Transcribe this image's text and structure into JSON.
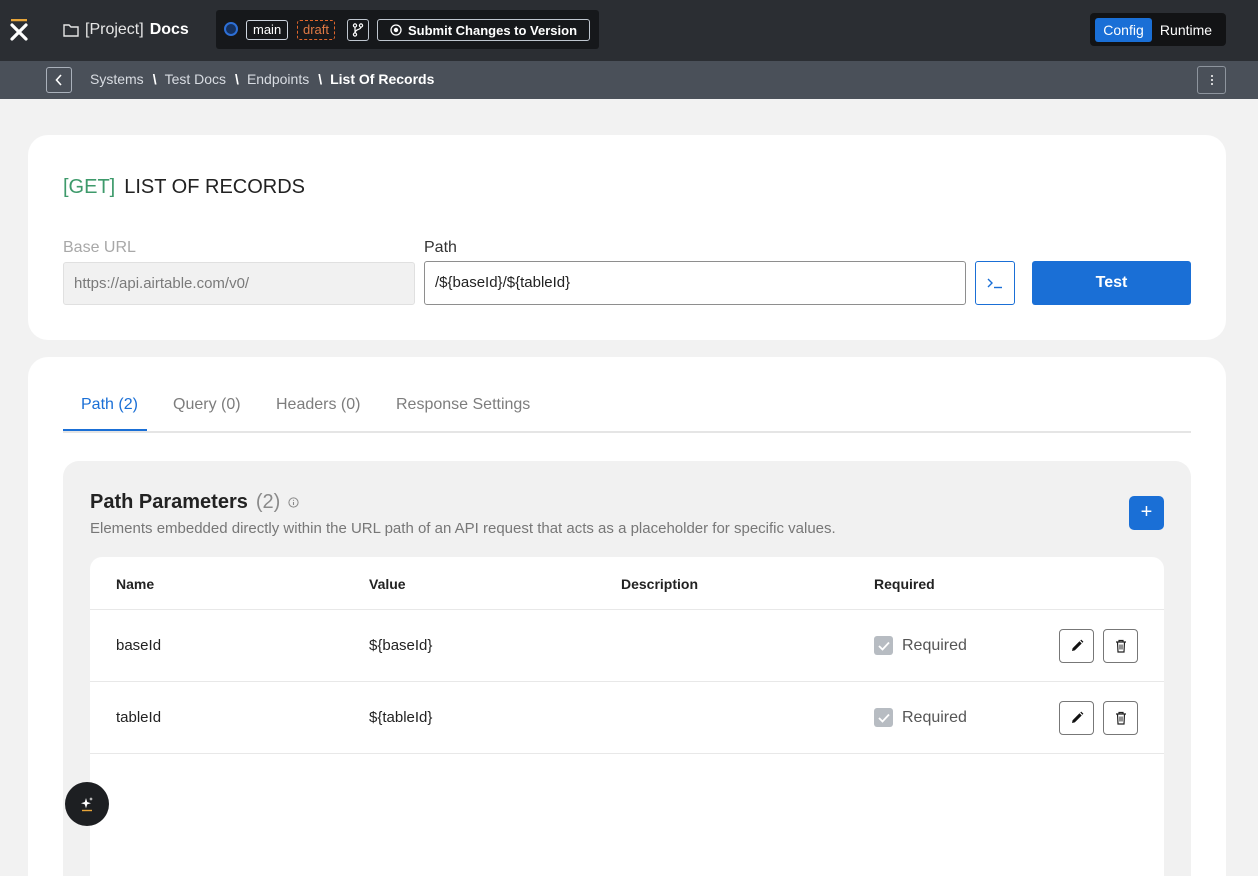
{
  "header": {
    "project_prefix": "[Project]",
    "project_name": "Docs",
    "branch": "main",
    "status": "draft",
    "submit_label": "Submit Changes to Version",
    "mode_config": "Config",
    "mode_runtime": "Runtime"
  },
  "breadcrumb": {
    "items": [
      "Systems",
      "Test Docs",
      "Endpoints",
      "List Of Records"
    ],
    "separator": "\\"
  },
  "endpoint": {
    "method": "[GET]",
    "name": "LIST OF RECORDS",
    "base_url_label": "Base URL",
    "base_url": "https://api.airtable.com/v0/",
    "path_label": "Path",
    "path": "/${baseId}/${tableId}",
    "test_label": "Test"
  },
  "tabs": [
    {
      "label": "Path (2)",
      "active": true
    },
    {
      "label": "Query (0)",
      "active": false
    },
    {
      "label": "Headers (0)",
      "active": false
    },
    {
      "label": "Response Settings",
      "active": false
    }
  ],
  "path_params": {
    "title": "Path Parameters",
    "count": "(2)",
    "description": "Elements embedded directly within the URL path of an API request that acts as a placeholder for specific values.",
    "add_label": "+",
    "columns": [
      "Name",
      "Value",
      "Description",
      "Required"
    ],
    "rows": [
      {
        "name": "baseId",
        "value": "${baseId}",
        "description": "",
        "required": "Required"
      },
      {
        "name": "tableId",
        "value": "${tableId}",
        "description": "",
        "required": "Required"
      }
    ]
  },
  "colors": {
    "accent": "#1a6fd6",
    "method_get": "#3e9a6b",
    "draft": "#e0662b",
    "header_bg": "#2b2e33"
  }
}
